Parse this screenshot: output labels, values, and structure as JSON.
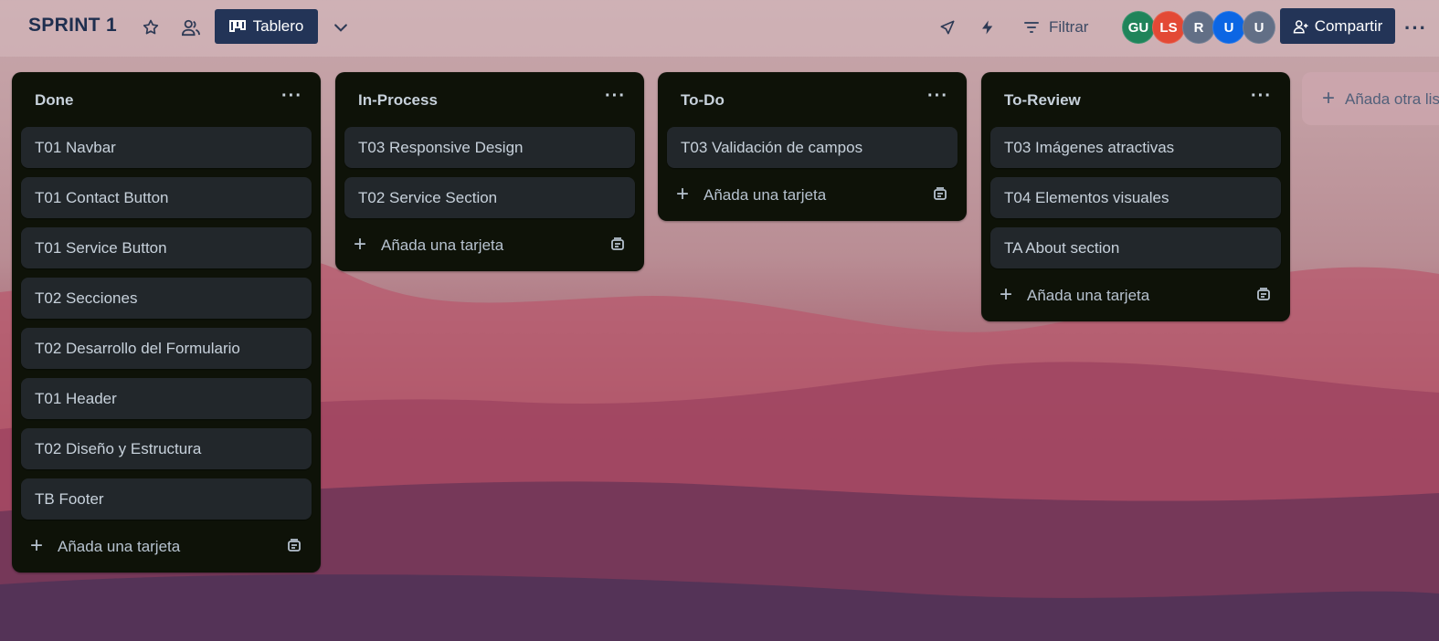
{
  "board": {
    "title": "SPRINT 1",
    "view_label": "Tablero",
    "filter_label": "Filtrar",
    "share_label": "Compartir",
    "members": [
      {
        "initials": "GU",
        "color": "#1f845a"
      },
      {
        "initials": "LS",
        "color": "#e34935"
      },
      {
        "initials": "R",
        "color": "#626f86"
      },
      {
        "initials": "U",
        "color": "#0c66e4"
      },
      {
        "initials": "U",
        "color": "#626f86"
      }
    ]
  },
  "lists": [
    {
      "title": "Done",
      "cards": [
        "T01 Navbar",
        "T01 Contact Button",
        "T01 Service Button",
        "T02 Secciones",
        "T02 Desarrollo del Formulario",
        "T01 Header",
        "T02 Diseño y Estructura",
        "TB Footer"
      ],
      "add_card_label": "Añada una tarjeta"
    },
    {
      "title": "In-Process",
      "cards": [
        "T03 Responsive Design",
        "T02 Service Section"
      ],
      "add_card_label": "Añada una tarjeta"
    },
    {
      "title": "To-Do",
      "cards": [
        "T03 Validación de campos"
      ],
      "add_card_label": "Añada una tarjeta"
    },
    {
      "title": "To-Review",
      "cards": [
        "T03 Imágenes atractivas",
        "T04 Elementos visuales",
        "TA About section"
      ],
      "add_card_label": "Añada una tarjeta"
    }
  ],
  "add_list_label": "Añada otra lista",
  "icons": {
    "star": "star-icon",
    "workspace": "workspace-visibility-icon",
    "board": "board-view-icon",
    "chevron": "chevron-down-icon",
    "powerups": "rocket-icon",
    "automation": "lightning-icon",
    "filter": "filter-icon",
    "share": "add-member-icon",
    "more": "more-icon",
    "template": "card-template-icon"
  }
}
